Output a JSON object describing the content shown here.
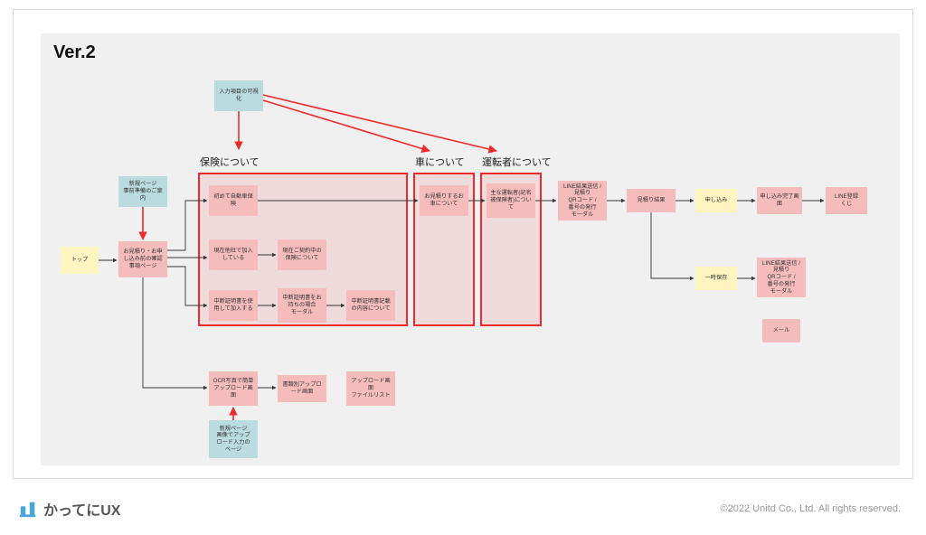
{
  "title": "Ver.2",
  "groupLabels": {
    "g1": "保険について",
    "g2": "車について",
    "g3": "運転者について"
  },
  "nodes": {
    "inputVis": "入力項目の可視化",
    "top": "トップ",
    "newGuide": "新規ページ\n事前準備のご案内",
    "confirm": "お見積り・お申\nし込み前の確認\n事項ページ",
    "firstCar": "初めて自動車保\n険",
    "joinedOther": "現在他社で加入\nしている",
    "currentContract": "現在ご契約中の\n保険について",
    "useInterrupt": "中断証明書を使\n用して加入する",
    "haveInterrupt": "中断証明書をお\n持ちの場合\nモーダル",
    "interruptContent": "中断証明書記載\nの内容について",
    "carQuote": "お見積りするお\n車について",
    "mainDriver": "主な運転者(記名\n被保険者)につい\nて",
    "lineResult1": "LINE結果送信 /\n見積り\nQRコード /\n番号の発行\nモーダル",
    "quoteResult": "見積り結果",
    "apply": "申し込み",
    "applyDone": "申し込み完了画\n面",
    "lineLottery": "LINE登録\nくじ",
    "tempSave": "一時保存",
    "lineResult2": "LINE結果送信 /\n見積り\nQRコード /\n番号の発行\nモーダル",
    "mail": "メール",
    "ocrUpload": "OCR写真で簡単\nアップロード画\n面",
    "docUpload": "書類別アップロ\nード画面",
    "uploadList": "アップロード画\n面\nファイルリスト",
    "newUploadPage": "新規ページ\n画像でアップ\nロード入力の\nページ"
  },
  "brand": "かってにUX",
  "copyright": "©2022 Unitd Co., Ltd. All rights reserved."
}
